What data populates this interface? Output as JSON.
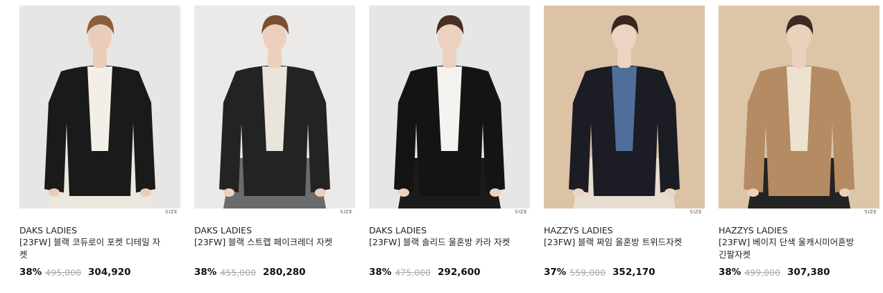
{
  "products": [
    {
      "brand": "DAKS LADIES",
      "title": "[23FW] 블랙 코듀로이 포켓 디테일 자켓",
      "discount": "38%",
      "original_price": "495,000",
      "price": "304,920",
      "size_label": "SIZE",
      "image": {
        "bg": "#e8e6e4",
        "coat": "#1a1a1a",
        "inner": "#f3efe8",
        "bottom": "#ece8df",
        "hair": "#8a5f3f",
        "skin": "#eacdb8"
      }
    },
    {
      "brand": "DAKS LADIES",
      "title": "[23FW] 블랙 스트랩 페이크레더 자켓",
      "discount": "38%",
      "original_price": "455,000",
      "price": "280,280",
      "size_label": "SIZE",
      "image": {
        "bg": "#eceae8",
        "coat": "#232323",
        "inner": "#e9e4dc",
        "bottom": "#6b6b6b",
        "hair": "#7b4f31",
        "skin": "#ecd0bd"
      }
    },
    {
      "brand": "DAKS LADIES",
      "title": "[23FW] 블랙 솔리드 울혼방 카라 자켓",
      "discount": "38%",
      "original_price": "475,000",
      "price": "292,600",
      "size_label": "SIZE",
      "image": {
        "bg": "#e6e6e6",
        "coat": "#141414",
        "inner": "#f5f3ef",
        "bottom": "#1b1b1b",
        "hair": "#4a2f22",
        "skin": "#ecd1bf"
      }
    },
    {
      "brand": "HAZZYS LADIES",
      "title": "[23FW] 블랙 짜임 울혼방 트위드자켓",
      "discount": "37%",
      "original_price": "559,000",
      "price": "352,170",
      "size_label": "SIZE",
      "image": {
        "bg": "#dcc3a6",
        "coat": "#1b1c24",
        "inner": "#4f6f9a",
        "bottom": "#e7ddd0",
        "hair": "#3a2620",
        "skin": "#edd3c1"
      }
    },
    {
      "brand": "HAZZYS LADIES",
      "title": "[23FW] 베이지 단색 울캐시미어혼방 긴팔자켓",
      "discount": "38%",
      "original_price": "499,000",
      "price": "307,380",
      "size_label": "SIZE",
      "image": {
        "bg": "#ddc6a8",
        "coat": "#b48b63",
        "inner": "#ece2cf",
        "bottom": "#232323",
        "hair": "#3d2a22",
        "skin": "#ecd0bc"
      }
    }
  ]
}
